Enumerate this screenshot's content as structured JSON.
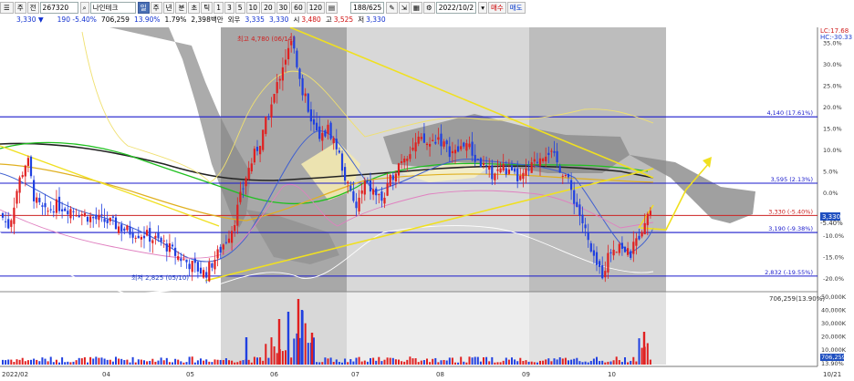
{
  "toolbar": {
    "menu_icon": "menu-icon",
    "period_label": "주",
    "prev_label": "전",
    "code": "267320",
    "search_icon": "search-icon",
    "stock_name": "나인테크",
    "tab_day": "일",
    "tab_week": "주",
    "tab_month": "년",
    "tab_minute": "분",
    "tab_tick": "초",
    "tab_time": "틱",
    "min_buttons": [
      "1",
      "3",
      "5",
      "10",
      "20",
      "30",
      "60",
      "120"
    ],
    "count_value": "188/625",
    "date_value": "2022/10/2",
    "buy_button": "매수",
    "sell_button": "매도",
    "price": "3,330",
    "price_arrow": "▼",
    "change": "190",
    "change_pct": "-5.40%",
    "volume": "706,259",
    "volume_pct": "13.90%",
    "turnover_pct": "1.79%",
    "amount": "2,398백만",
    "credit_label": "외우",
    "credit_value": "3,335",
    "prev_value": "3,330",
    "open_label": "시",
    "open_value": "3,480",
    "high_label": "고",
    "high_value": "3,525",
    "low_label": "저",
    "low_value": "3,330"
  },
  "chart_data": {
    "type": "candlestick",
    "title": "",
    "ylim_pct": [
      -23.5,
      38
    ],
    "right_axis_pct_ticks": [
      "35.0%",
      "30.0%",
      "25.0%",
      "20.0%",
      "15.0%",
      "10.0%",
      "5.0%",
      "0.0%",
      "-5.0%",
      "-10.0%",
      "-15.0%",
      "-20.0%"
    ],
    "top_right_labels": [
      "LC:17.68",
      "HC:-30.33"
    ],
    "volume_ticks": [
      "50,000K",
      "40,000K",
      "30,000K",
      "20,000K",
      "10,000K"
    ],
    "volume_readout": "706,259(13.90%)",
    "volume_badge": "706,259",
    "volume_pct_badge": "13.90%",
    "price_badge": "3,330",
    "x_tick_labels": [
      "2022/02",
      "04",
      "05",
      "06",
      "07",
      "08",
      "09",
      "10",
      "10/21"
    ],
    "annotations": {
      "high": "최고 4,780 (06/14)",
      "low": "최저 2,825 (05/10)"
    },
    "horizontal_levels": [
      {
        "label": "4,140 (17.61%)",
        "pct": 17.61,
        "color": "#1a1acc"
      },
      {
        "label": "3,595 (2.13%)",
        "pct": 2.13,
        "color": "#1a1acc"
      },
      {
        "label": "3,330 (-5.40%)",
        "pct": -5.4,
        "color": "#cc2222"
      },
      {
        "label": "3,190 (-9.38%)",
        "pct": -9.38,
        "color": "#1a1acc"
      },
      {
        "label": "2,832 (-19.55%)",
        "pct": -19.55,
        "color": "#1a1acc"
      }
    ],
    "right_extra_ticks": [
      "-5.40%",
      "-10.0%"
    ],
    "colors": {
      "up": "#e02020",
      "down": "#2040e0",
      "level": "#1a1acc",
      "trend": "#f0e020"
    }
  }
}
